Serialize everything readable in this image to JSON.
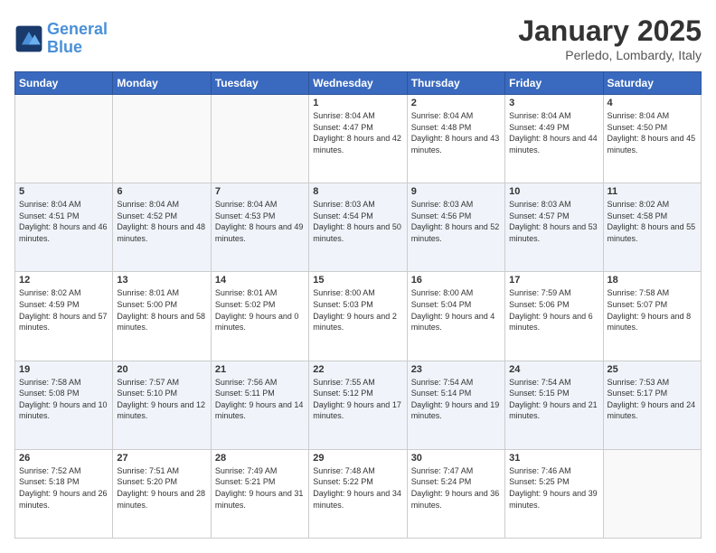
{
  "header": {
    "logo_line1": "General",
    "logo_line2": "Blue",
    "month": "January 2025",
    "location": "Perledo, Lombardy, Italy"
  },
  "days_of_week": [
    "Sunday",
    "Monday",
    "Tuesday",
    "Wednesday",
    "Thursday",
    "Friday",
    "Saturday"
  ],
  "weeks": [
    [
      {
        "day": "",
        "info": ""
      },
      {
        "day": "",
        "info": ""
      },
      {
        "day": "",
        "info": ""
      },
      {
        "day": "1",
        "info": "Sunrise: 8:04 AM\nSunset: 4:47 PM\nDaylight: 8 hours and 42 minutes."
      },
      {
        "day": "2",
        "info": "Sunrise: 8:04 AM\nSunset: 4:48 PM\nDaylight: 8 hours and 43 minutes."
      },
      {
        "day": "3",
        "info": "Sunrise: 8:04 AM\nSunset: 4:49 PM\nDaylight: 8 hours and 44 minutes."
      },
      {
        "day": "4",
        "info": "Sunrise: 8:04 AM\nSunset: 4:50 PM\nDaylight: 8 hours and 45 minutes."
      }
    ],
    [
      {
        "day": "5",
        "info": "Sunrise: 8:04 AM\nSunset: 4:51 PM\nDaylight: 8 hours and 46 minutes."
      },
      {
        "day": "6",
        "info": "Sunrise: 8:04 AM\nSunset: 4:52 PM\nDaylight: 8 hours and 48 minutes."
      },
      {
        "day": "7",
        "info": "Sunrise: 8:04 AM\nSunset: 4:53 PM\nDaylight: 8 hours and 49 minutes."
      },
      {
        "day": "8",
        "info": "Sunrise: 8:03 AM\nSunset: 4:54 PM\nDaylight: 8 hours and 50 minutes."
      },
      {
        "day": "9",
        "info": "Sunrise: 8:03 AM\nSunset: 4:56 PM\nDaylight: 8 hours and 52 minutes."
      },
      {
        "day": "10",
        "info": "Sunrise: 8:03 AM\nSunset: 4:57 PM\nDaylight: 8 hours and 53 minutes."
      },
      {
        "day": "11",
        "info": "Sunrise: 8:02 AM\nSunset: 4:58 PM\nDaylight: 8 hours and 55 minutes."
      }
    ],
    [
      {
        "day": "12",
        "info": "Sunrise: 8:02 AM\nSunset: 4:59 PM\nDaylight: 8 hours and 57 minutes."
      },
      {
        "day": "13",
        "info": "Sunrise: 8:01 AM\nSunset: 5:00 PM\nDaylight: 8 hours and 58 minutes."
      },
      {
        "day": "14",
        "info": "Sunrise: 8:01 AM\nSunset: 5:02 PM\nDaylight: 9 hours and 0 minutes."
      },
      {
        "day": "15",
        "info": "Sunrise: 8:00 AM\nSunset: 5:03 PM\nDaylight: 9 hours and 2 minutes."
      },
      {
        "day": "16",
        "info": "Sunrise: 8:00 AM\nSunset: 5:04 PM\nDaylight: 9 hours and 4 minutes."
      },
      {
        "day": "17",
        "info": "Sunrise: 7:59 AM\nSunset: 5:06 PM\nDaylight: 9 hours and 6 minutes."
      },
      {
        "day": "18",
        "info": "Sunrise: 7:58 AM\nSunset: 5:07 PM\nDaylight: 9 hours and 8 minutes."
      }
    ],
    [
      {
        "day": "19",
        "info": "Sunrise: 7:58 AM\nSunset: 5:08 PM\nDaylight: 9 hours and 10 minutes."
      },
      {
        "day": "20",
        "info": "Sunrise: 7:57 AM\nSunset: 5:10 PM\nDaylight: 9 hours and 12 minutes."
      },
      {
        "day": "21",
        "info": "Sunrise: 7:56 AM\nSunset: 5:11 PM\nDaylight: 9 hours and 14 minutes."
      },
      {
        "day": "22",
        "info": "Sunrise: 7:55 AM\nSunset: 5:12 PM\nDaylight: 9 hours and 17 minutes."
      },
      {
        "day": "23",
        "info": "Sunrise: 7:54 AM\nSunset: 5:14 PM\nDaylight: 9 hours and 19 minutes."
      },
      {
        "day": "24",
        "info": "Sunrise: 7:54 AM\nSunset: 5:15 PM\nDaylight: 9 hours and 21 minutes."
      },
      {
        "day": "25",
        "info": "Sunrise: 7:53 AM\nSunset: 5:17 PM\nDaylight: 9 hours and 24 minutes."
      }
    ],
    [
      {
        "day": "26",
        "info": "Sunrise: 7:52 AM\nSunset: 5:18 PM\nDaylight: 9 hours and 26 minutes."
      },
      {
        "day": "27",
        "info": "Sunrise: 7:51 AM\nSunset: 5:20 PM\nDaylight: 9 hours and 28 minutes."
      },
      {
        "day": "28",
        "info": "Sunrise: 7:49 AM\nSunset: 5:21 PM\nDaylight: 9 hours and 31 minutes."
      },
      {
        "day": "29",
        "info": "Sunrise: 7:48 AM\nSunset: 5:22 PM\nDaylight: 9 hours and 34 minutes."
      },
      {
        "day": "30",
        "info": "Sunrise: 7:47 AM\nSunset: 5:24 PM\nDaylight: 9 hours and 36 minutes."
      },
      {
        "day": "31",
        "info": "Sunrise: 7:46 AM\nSunset: 5:25 PM\nDaylight: 9 hours and 39 minutes."
      },
      {
        "day": "",
        "info": ""
      }
    ]
  ]
}
